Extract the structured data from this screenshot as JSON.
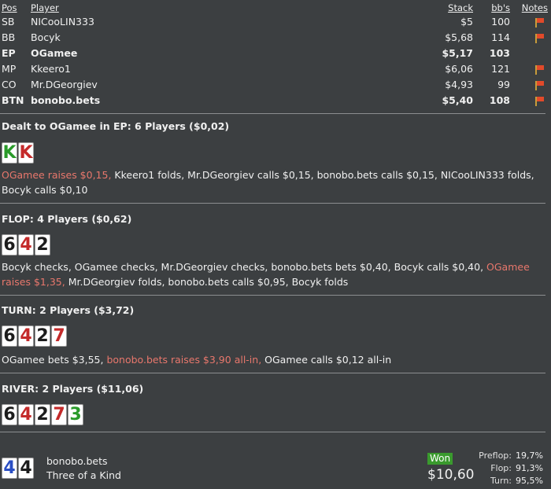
{
  "table": {
    "headers": {
      "pos": "Pos",
      "player": "Player",
      "stack": "Stack",
      "bb": "bb's",
      "notes": "Notes"
    },
    "players": [
      {
        "pos": "SB",
        "name": "NICooLIN333",
        "stack": "$5",
        "bb": "100",
        "hero": false
      },
      {
        "pos": "BB",
        "name": "Bocyk",
        "stack": "$5,68",
        "bb": "114",
        "hero": false
      },
      {
        "pos": "EP",
        "name": "OGamee",
        "stack": "$5,17",
        "bb": "103",
        "hero": true
      },
      {
        "pos": "MP",
        "name": "Kkeero1",
        "stack": "$6,06",
        "bb": "121",
        "hero": false
      },
      {
        "pos": "CO",
        "name": "Mr.DGeorgiev",
        "stack": "$4,93",
        "bb": "99",
        "hero": false
      },
      {
        "pos": "BTN",
        "name": "bonobo.bets",
        "stack": "$5,40",
        "bb": "108",
        "hero": true
      }
    ],
    "note_icon": "flag-icon",
    "flag_colors": {
      "pole": "#c89c3a",
      "flag": "#e24a2a"
    }
  },
  "preflop": {
    "heading": "Dealt to OGamee in EP: 6 Players ($0,02)",
    "cards": [
      {
        "rank": "K",
        "suit": "club"
      },
      {
        "rank": "K",
        "suit": "heart"
      }
    ],
    "action_hl": "OGamee raises $0,15,",
    "action_rest": " Kkeero1 folds, Mr.DGeorgiev calls $0,15, bonobo.bets calls $0,15, NICooLIN333 folds, Bocyk calls $0,10"
  },
  "flop": {
    "heading": "FLOP: 4 Players ($0,62)",
    "cards": [
      {
        "rank": "6",
        "suit": "spade"
      },
      {
        "rank": "4",
        "suit": "heart"
      },
      {
        "rank": "2",
        "suit": "spade"
      }
    ],
    "action_pre": "Bocyk checks, OGamee checks, Mr.DGeorgiev checks, bonobo.bets bets $0,40, Bocyk calls $0,40, ",
    "action_hl": "OGamee raises $1,35,",
    "action_post": " Mr.DGeorgiev folds, bonobo.bets calls $0,95, Bocyk folds"
  },
  "turn": {
    "heading": "TURN: 2 Players ($3,72)",
    "cards": [
      {
        "rank": "6",
        "suit": "spade"
      },
      {
        "rank": "4",
        "suit": "heart"
      },
      {
        "rank": "2",
        "suit": "spade"
      },
      {
        "rank": "7",
        "suit": "heart"
      }
    ],
    "action_pre": "OGamee bets $3,55, ",
    "action_hl": "bonobo.bets raises $3,90 all-in,",
    "action_post": " OGamee calls $0,12 all-in"
  },
  "river": {
    "heading": "RIVER: 2 Players ($11,06)",
    "cards": [
      {
        "rank": "6",
        "suit": "spade"
      },
      {
        "rank": "4",
        "suit": "heart"
      },
      {
        "rank": "2",
        "suit": "spade"
      },
      {
        "rank": "7",
        "suit": "heart"
      },
      {
        "rank": "3",
        "suit": "club"
      }
    ]
  },
  "result": {
    "cards": [
      {
        "rank": "4",
        "suit": "diamond"
      },
      {
        "rank": "4",
        "suit": "spade"
      }
    ],
    "winner": "bonobo.bets",
    "hand": "Three of a Kind",
    "won_label": "Won",
    "amount": "$10,60",
    "equity": [
      {
        "label": "Preflop:",
        "value": "19,7%"
      },
      {
        "label": "Flop:",
        "value": "91,3%"
      },
      {
        "label": "Turn:",
        "value": "95,5%"
      }
    ]
  },
  "colors": {
    "background": "#3c3f41",
    "highlight": "#e8776c",
    "won_badge": "#3a9a2e",
    "suit_spade": "#1c1c1c",
    "suit_heart": "#c42a2a",
    "suit_club": "#2a9a2a",
    "suit_diamond": "#2a4ec4"
  }
}
